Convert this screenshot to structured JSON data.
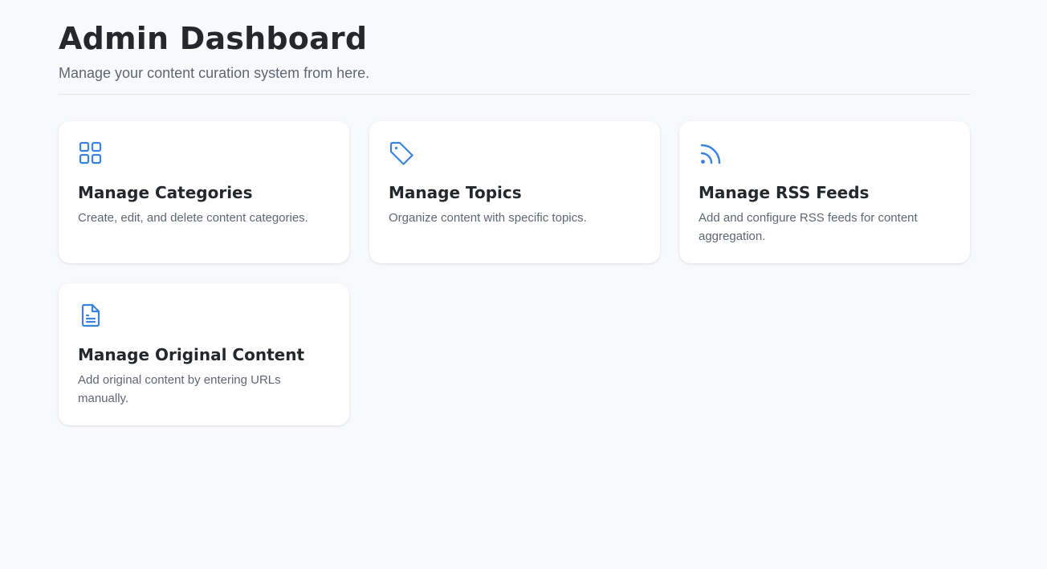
{
  "header": {
    "title": "Admin Dashboard",
    "subtitle": "Manage your content curation system from here."
  },
  "accent_color": "#3b82e0",
  "cards": [
    {
      "icon": "grid-icon",
      "title": "Manage Categories",
      "description": "Create, edit, and delete content categories."
    },
    {
      "icon": "tag-icon",
      "title": "Manage Topics",
      "description": "Organize content with specific topics."
    },
    {
      "icon": "rss-icon",
      "title": "Manage RSS Feeds",
      "description": "Add and configure RSS feeds for content aggregation."
    },
    {
      "icon": "document-icon",
      "title": "Manage Original Content",
      "description": "Add original content by entering URLs manually."
    }
  ]
}
